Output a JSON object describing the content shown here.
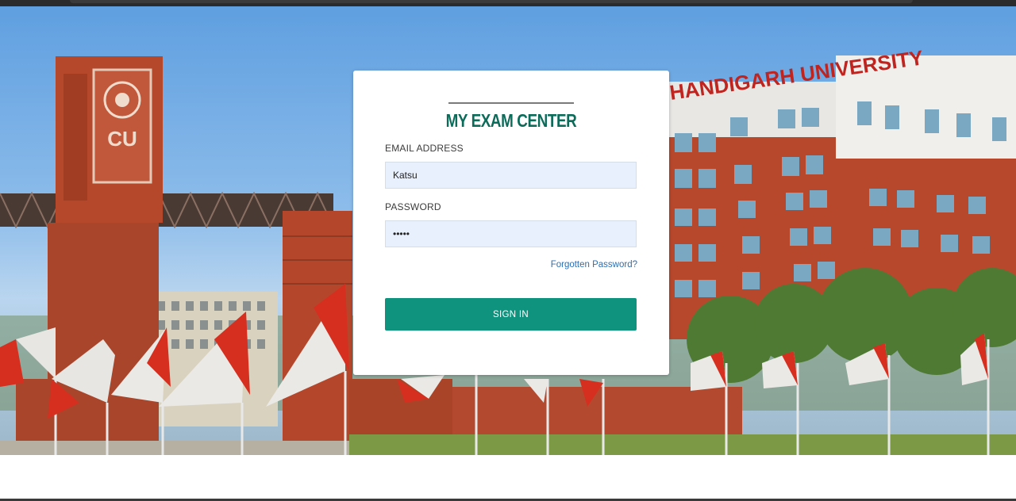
{
  "login": {
    "logo_text": "MY EXAM CENTER",
    "email_label": "EMAIL ADDRESS",
    "email_value": "Katsu",
    "password_label": "PASSWORD",
    "password_value": "12345",
    "forgot_link": "Forgotten Password?",
    "signin_label": "SIGN IN"
  },
  "background": {
    "building_sign": "CHANDIGARH UNIVERSITY",
    "tower_logo": "CU"
  },
  "colors": {
    "accent": "#10937e",
    "logo": "#0d6b5a",
    "link": "#2a6fb3",
    "input_bg": "#e8f0fe"
  }
}
